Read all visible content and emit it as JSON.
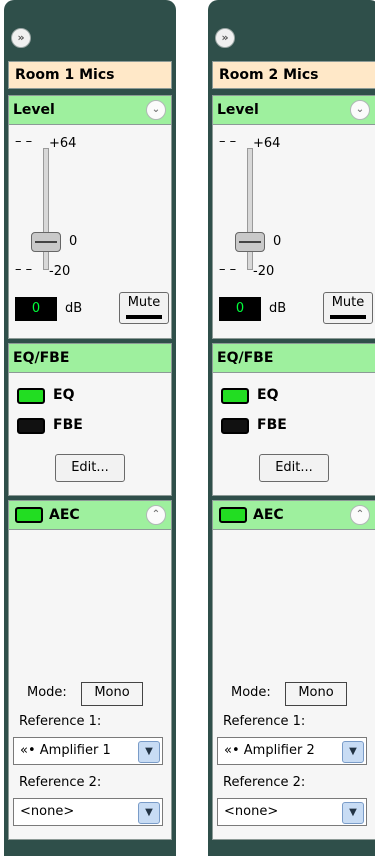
{
  "icons": {
    "expand": "»",
    "collapse_down": "⌄",
    "collapse_up": "⌃",
    "dropdown": "▼",
    "speaker": "«•"
  },
  "strips": [
    {
      "name": "Room 1 Mics",
      "level": {
        "title": "Level",
        "tick_top": "+64",
        "tick_mid": "0",
        "tick_bottom": "-20",
        "db_value": "0",
        "db_unit": "dB",
        "mute_label": "Mute"
      },
      "eq": {
        "title": "EQ/FBE",
        "eq_label": "EQ",
        "eq_on": true,
        "fbe_label": "FBE",
        "fbe_on": false,
        "edit_label": "Edit..."
      },
      "aec": {
        "title": "AEC",
        "aec_on": true,
        "mode_label": "Mode:",
        "mode_value": "Mono",
        "ref1_label": "Reference 1:",
        "ref1_value": "Amplifier 1",
        "ref2_label": "Reference 2:",
        "ref2_value": "<none>"
      }
    },
    {
      "name": "Room 2 Mics",
      "level": {
        "title": "Level",
        "tick_top": "+64",
        "tick_mid": "0",
        "tick_bottom": "-20",
        "db_value": "0",
        "db_unit": "dB",
        "mute_label": "Mute"
      },
      "eq": {
        "title": "EQ/FBE",
        "eq_label": "EQ",
        "eq_on": true,
        "fbe_label": "FBE",
        "fbe_on": false,
        "edit_label": "Edit..."
      },
      "aec": {
        "title": "AEC",
        "aec_on": true,
        "mode_label": "Mode:",
        "mode_value": "Mono",
        "ref1_label": "Reference 1:",
        "ref1_value": "Amplifier 2",
        "ref2_label": "Reference 2:",
        "ref2_value": "<none>"
      }
    }
  ],
  "colors": {
    "strip_bg": "#2f4f4a",
    "header_green": "#9ef09e",
    "name_bg": "#ffe8c8",
    "led_on": "#22dd22",
    "meter_text": "#00ff3a"
  }
}
